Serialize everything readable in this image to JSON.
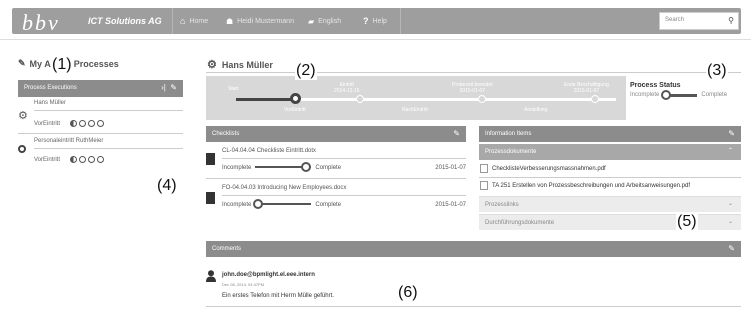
{
  "header": {
    "logo": "bbv",
    "company": "ICT Solutions AG",
    "nav": [
      {
        "label": "Home",
        "icon": "home-icon"
      },
      {
        "label": "Heidi Mustermann",
        "icon": "user-icon"
      },
      {
        "label": "English",
        "icon": "flag-icon"
      },
      {
        "label": "Help",
        "icon": "question-icon"
      }
    ],
    "search_placeholder": "Search"
  },
  "annotations": [
    "(1)",
    "(2)",
    "(3)",
    "(4)",
    "(5)",
    "(6)"
  ],
  "left": {
    "title": "My Active Processes",
    "panel_title": "Process Executions",
    "items": [
      {
        "name": "Hans Müller",
        "step": "VorEintritt"
      },
      {
        "name": "Personaleintritt RuthMeier",
        "step": "VorEintritt"
      }
    ]
  },
  "main": {
    "person": "Hans Müller",
    "timeline": {
      "milestones": [
        {
          "title": "Start",
          "date": ""
        },
        {
          "title": "Eintritt",
          "date": "2014-12-16"
        },
        {
          "title": "Probezeit beendet",
          "date": "2015-01-07"
        },
        {
          "title": "Ende Beschäftigung",
          "date": "2015-01-07"
        }
      ],
      "phases": [
        "VorEintritt",
        "NachEintritt",
        "Anstellung"
      ]
    },
    "status": {
      "title": "Process Status",
      "from": "Incomplete",
      "to": "Complete",
      "value": 0
    },
    "checklists": {
      "title": "Checklists",
      "items": [
        {
          "name": "CL-04.04.04 Checkliste Eintritt.dotx",
          "from": "Incomplete",
          "to": "Complete",
          "date": "2015-01-07",
          "progress": 1
        },
        {
          "name": "FO-04.04.03 Introducing New Employees.docx",
          "from": "Incomplete",
          "to": "Complete",
          "date": "2015-01-07",
          "progress": 0
        }
      ]
    },
    "info": {
      "title": "Information Items",
      "sections": [
        {
          "title": "Prozessdokumente",
          "files": [
            "ChecklisteVerbesserungsmassnahmen.pdf",
            "TA 251 Erstellen von Prozessbeschreibungen und Arbeitsanweisungen.pdf"
          ]
        },
        {
          "title": "Prozesslinks"
        },
        {
          "title": "Durchführungsdokumente"
        }
      ]
    },
    "comments": {
      "title": "Comments",
      "items": [
        {
          "author": "john.doe@bpmlight.el.eee.intern",
          "date": "Dec 08, 2014. 04:47PM",
          "text": "Ein erstes Telefon mit Herrn Mülle geführt."
        }
      ]
    }
  }
}
